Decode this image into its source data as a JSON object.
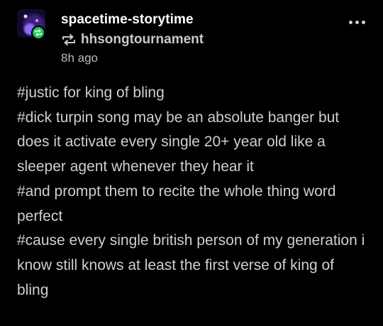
{
  "post": {
    "username": "spacetime-storytime",
    "reblogged_from": "hhsongtournament",
    "timestamp": "8h ago",
    "tags": [
      "#justic for king of bling",
      "#dick turpin song may be an absolute banger but does it activate every single 20+ year old like a sleeper agent whenever they hear it",
      "#and prompt them to recite the whole thing word perfect",
      "#cause every single british person of my generation i know still knows at least the first verse of king of bling"
    ]
  },
  "icons": {
    "avatar": "avatar-image",
    "badge": "reblog-badge-icon",
    "reblog": "reblog-icon",
    "more": "more-options-icon"
  },
  "colors": {
    "background": "#000000",
    "badge": "#1ec45a",
    "text": "#cfcfcf"
  }
}
